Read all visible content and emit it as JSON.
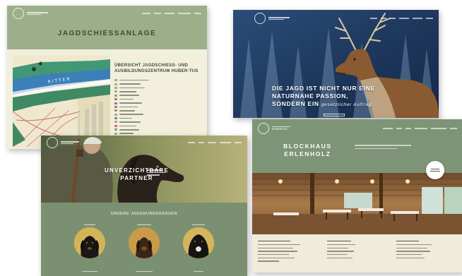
{
  "card1": {
    "title": "JAGDSCHIESSANLAGE",
    "sidebar_title": "ÜBERSICHT JAGDSCHIESS- UND AUSBILDUNGSZENTRUM HUBER-TUS",
    "map_label": "RITTER"
  },
  "card2": {
    "headline_line1": "DIE JAGD IST NICHT NUR EINE",
    "headline_line2": "NATURNAHE PASSION,",
    "headline_line3": "SONDERN EIN",
    "headline_small": "gesetzlicher Auftrag."
  },
  "card3": {
    "headline_line1": "UNVERZICHTBARE",
    "headline_line2": "PARTNER",
    "section_title": "UNSERE JAGDHUNDERASSEN"
  },
  "card4": {
    "brand_name": "HUBERTUS",
    "title_line1": "BLOCKHAUS",
    "title_line2": "ERLENHOLZ"
  },
  "colors": {
    "sage": "#9caf8a",
    "cream": "#f3efdd",
    "forest_green": "#7b9070",
    "night_blue": "#1e3b62",
    "deer_brown": "#8a5b32"
  }
}
